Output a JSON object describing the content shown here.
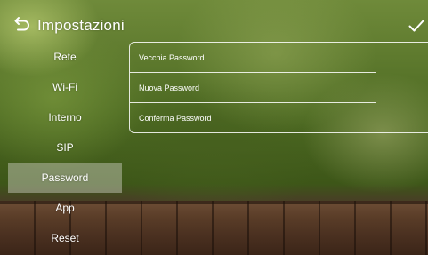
{
  "header": {
    "title": "Impostazioni",
    "back_icon": "back-arrow-icon",
    "confirm_icon": "check-icon"
  },
  "sidebar": {
    "items": [
      {
        "label": "Rete"
      },
      {
        "label": "Wi-Fi"
      },
      {
        "label": "Interno"
      },
      {
        "label": "SIP"
      },
      {
        "label": "Password",
        "active": true
      },
      {
        "label": "App"
      },
      {
        "label": "Reset"
      }
    ]
  },
  "password_form": {
    "old_password_placeholder": "Vecchia Password",
    "new_password_placeholder": "Nuova Password",
    "confirm_password_placeholder": "Conferma Password"
  },
  "colors": {
    "text": "#ffffff",
    "active_item_bg": "#d2d2c8"
  }
}
